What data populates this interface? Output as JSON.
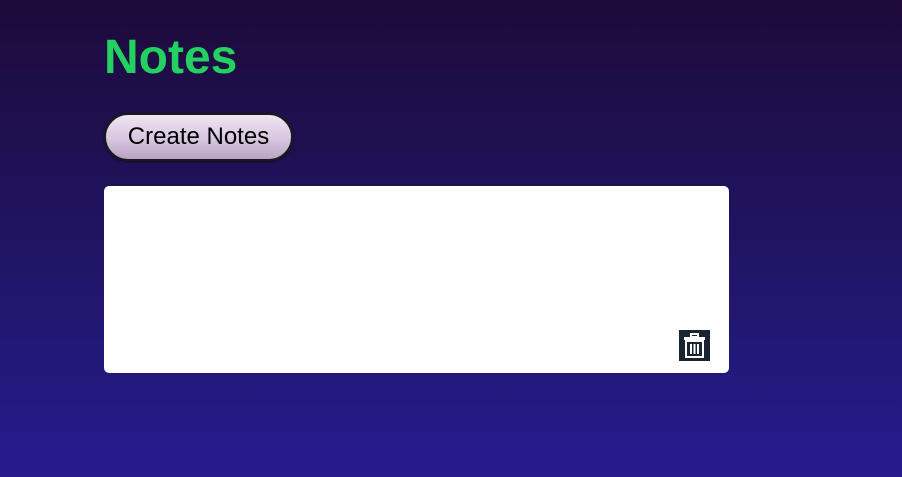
{
  "page": {
    "title": "Notes"
  },
  "toolbar": {
    "create_label": "Create Notes"
  },
  "notes": [
    {
      "content": "",
      "delete_icon": "trash-icon"
    }
  ],
  "colors": {
    "title": "#22d160",
    "background_top": "#1d0a3a",
    "background_bottom": "#241c8f",
    "note_background": "#ffffff",
    "delete_button_background": "#1b2431"
  }
}
